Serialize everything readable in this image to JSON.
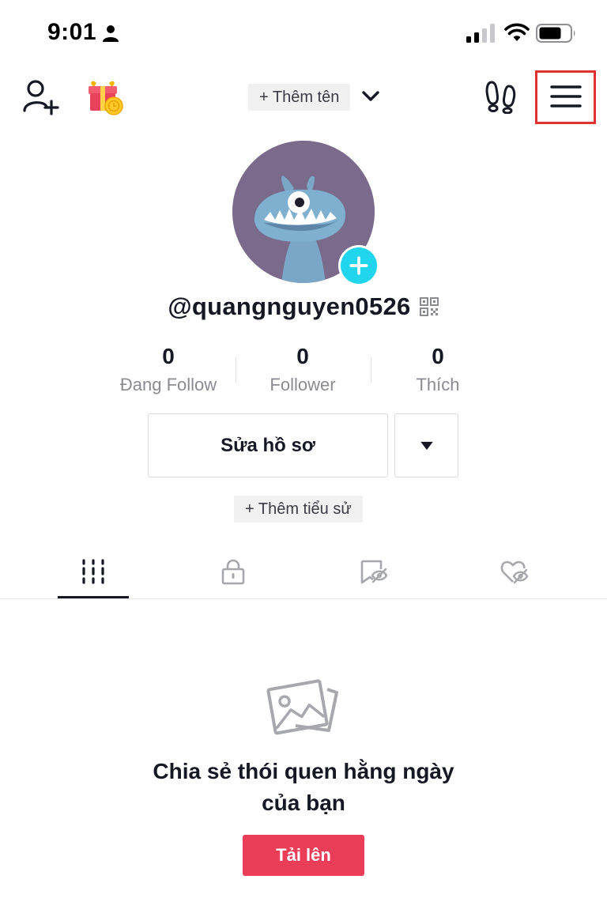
{
  "status_bar": {
    "time": "9:01"
  },
  "top_nav": {
    "add_name_label": "+ Thêm tên",
    "icons": [
      "add-friend-icon",
      "gift-icon",
      "chevron-down-icon",
      "footprints-icon",
      "hamburger-menu-icon"
    ]
  },
  "profile": {
    "username": "@quangnguyen0526"
  },
  "stats": [
    {
      "value": "0",
      "label": "Đang Follow"
    },
    {
      "value": "0",
      "label": "Follower"
    },
    {
      "value": "0",
      "label": "Thích"
    }
  ],
  "actions": {
    "edit_profile_label": "Sửa hồ sơ",
    "add_bio_label": "+ Thêm tiểu sử"
  },
  "tabs": [
    "videos-grid-icon",
    "lock-icon",
    "repost-hidden-icon",
    "liked-hidden-icon"
  ],
  "empty_state": {
    "title_line1": "Chia sẻ thói quen hằng ngày",
    "title_line2": "của bạn",
    "upload_label": "Tải lên"
  },
  "colors": {
    "accent": "#ea3e58",
    "highlight_box": "#e0322f",
    "avatar_plus": "#20d5ec"
  }
}
